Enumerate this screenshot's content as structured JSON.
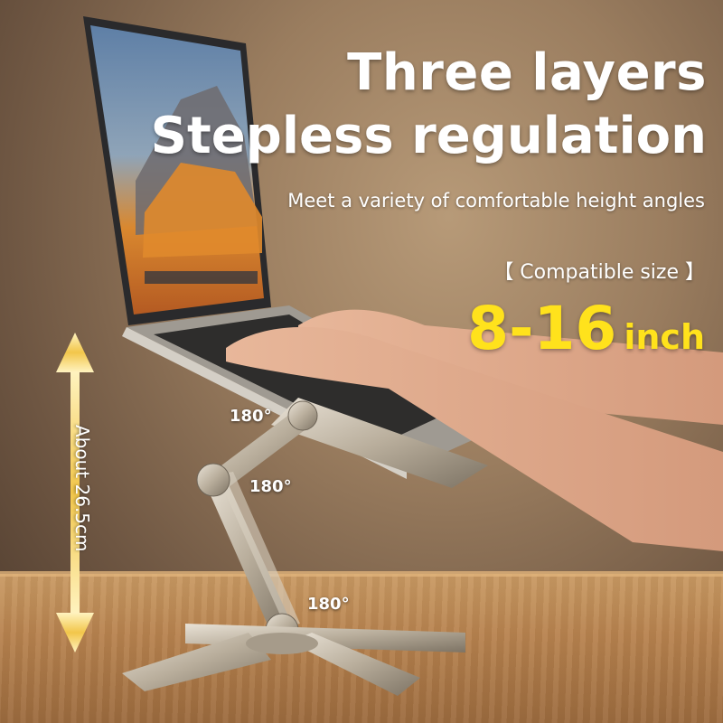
{
  "headline": {
    "line1": "Three layers",
    "line2": "Stepless regulation"
  },
  "subtitle": "Meet a variety of comfortable height angles",
  "compatible": {
    "label": "【 Compatible size 】",
    "size": "8-16",
    "unit": "inch"
  },
  "height_label": "About 26.5cm",
  "angles": [
    "180°",
    "180°",
    "180°"
  ],
  "colors": {
    "size_highlight": "#ffe21c",
    "arrow": "#f2c64a",
    "text": "#ffffff"
  }
}
